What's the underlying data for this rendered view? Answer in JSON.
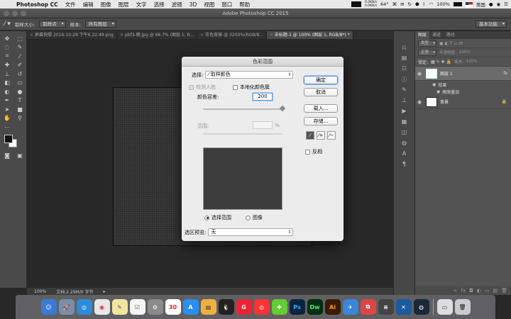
{
  "menubar": {
    "app": "Photoshop CC",
    "items": [
      "文件",
      "编辑",
      "图像",
      "图层",
      "文字",
      "选择",
      "滤镜",
      "3D",
      "视图",
      "窗口",
      "帮助"
    ],
    "net_up": "0.0KB/s",
    "net_down": "0.0KB/s",
    "temp": "64°",
    "battery": "100%",
    "input_source": "美国"
  },
  "window": {
    "title": "Adobe Photoshop CC 2015"
  },
  "options_bar": {
    "sample_size_label": "取样大小:",
    "sample_size_value": "取样点",
    "sample_label": "样本:",
    "sample_value": "所有图层",
    "workspace": "基本功能"
  },
  "tabs": [
    {
      "label": "屏幕快照 2016-10-29 下午6.22.49.png",
      "active": false
    },
    {
      "label": "pbf3-晚.jpg @ 66.7% (图层 1, R...",
      "active": false
    },
    {
      "label": "灰色背景 @ 3200%(RGB/8...",
      "active": false
    },
    {
      "label": "未标题-1 @ 100% (图层 1, RGB/8*) *",
      "active": true
    }
  ],
  "status": {
    "zoom": "100%",
    "doc_info": "文档:2.29M/0 字节"
  },
  "layers_panel": {
    "tabs": [
      "图层",
      "通道",
      "路径"
    ],
    "kind_label": "类型",
    "blend_mode": "正常",
    "opacity_label": "不透明度:",
    "opacity_value": "100%",
    "lock_label": "锁定:",
    "fill_label": "填充:",
    "fill_value": "100%",
    "layers": [
      {
        "name": "图层 1",
        "active": true,
        "fx": true
      },
      {
        "name": "背景",
        "active": false,
        "fx": false
      }
    ],
    "effects_label": "效果",
    "effect_item": "图案叠加"
  },
  "dialog": {
    "title": "色彩范围",
    "select_label": "选择:",
    "select_value": "取样颜色",
    "detect_faces": "检测人脸",
    "localized": "本地化颜色簇",
    "fuzziness_label": "颜色容差:",
    "fuzziness_value": "200",
    "fuzziness_level": 1.0,
    "range_label": "范围:",
    "range_unit": "%",
    "radio_selection": "选择范围",
    "radio_image": "图像",
    "preview_label": "选区预览:",
    "preview_value": "无",
    "ok": "确定",
    "cancel": "取消",
    "load": "载入...",
    "save": "存储...",
    "invert": "反相"
  }
}
